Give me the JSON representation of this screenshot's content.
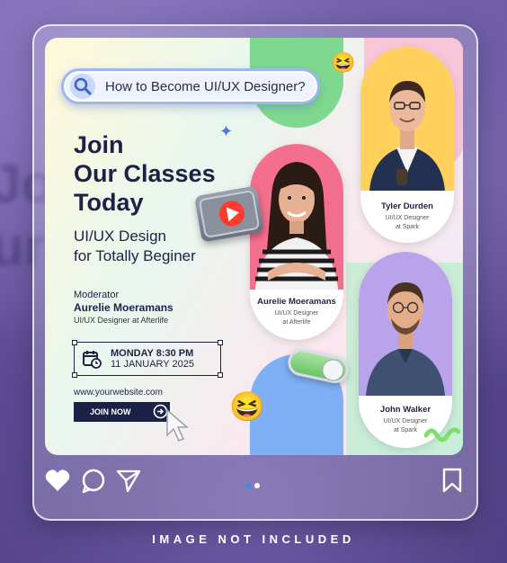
{
  "search": {
    "text": "How to Become UI/UX Designer?"
  },
  "headline": {
    "line1": "Join",
    "line2": "Our Classes",
    "line3": "Today"
  },
  "subhead": {
    "line1": "UI/UX Design",
    "line2": "for Totally Beginer"
  },
  "moderator": {
    "role": "Moderator",
    "name": "Aurelie Moeramans",
    "title": "UI/UX Designer at Afterlife"
  },
  "event": {
    "day": "MONDAY 8:30 PM",
    "date": "11 JANUARY 2025"
  },
  "website": "www.yourwebsite.com",
  "cta": {
    "label": "JOIN NOW"
  },
  "speakers": [
    {
      "name": "Tyler Durden",
      "role_line1": "UI/UX Designer",
      "role_line2": "at Spark"
    },
    {
      "name": "Aurelie Moeramans",
      "role_line1": "UI/UX Designer",
      "role_line2": "at Afterlife"
    },
    {
      "name": "John Walker",
      "role_line1": "UI/UX Designer",
      "role_line2": "at Spark"
    }
  ],
  "carousel": {
    "active_index": 0,
    "count": 2
  },
  "footer_note": "IMAGE NOT INCLUDED",
  "colors": {
    "navy": "#1e2147",
    "active_dot": "#3b8ee8",
    "inactive_dot": "#ffffff"
  }
}
